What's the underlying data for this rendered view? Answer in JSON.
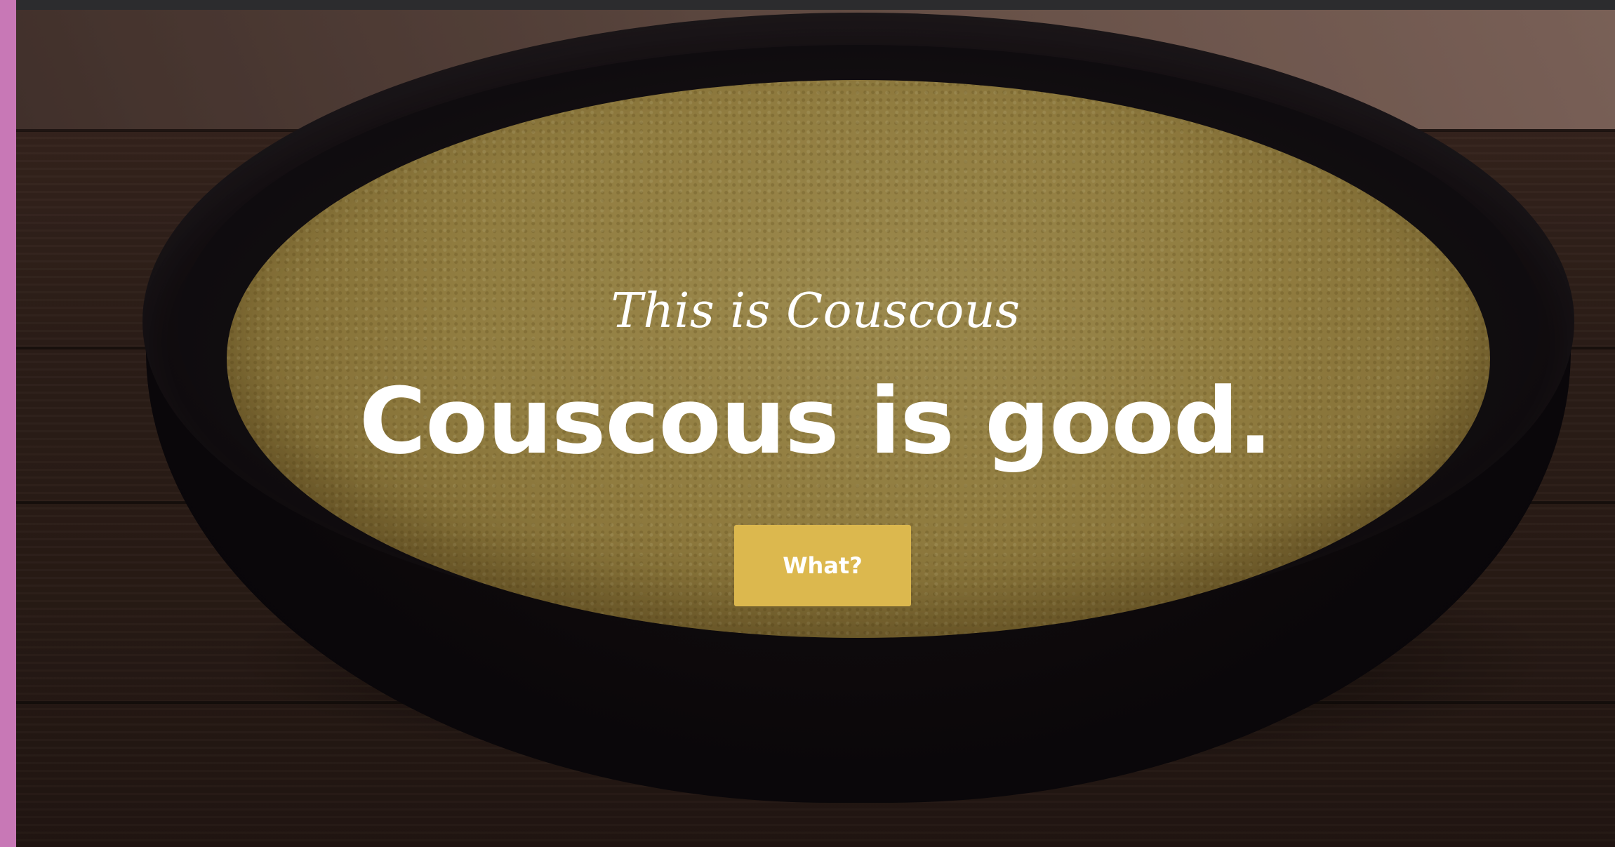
{
  "hero": {
    "kicker": "This is Couscous",
    "headline": "Couscous is good.",
    "cta_label": "What?"
  },
  "colors": {
    "accent": "#dcb84e",
    "side_stripe": "#c878b6",
    "top_bar": "#2c2c2e",
    "text": "#ffffff"
  }
}
